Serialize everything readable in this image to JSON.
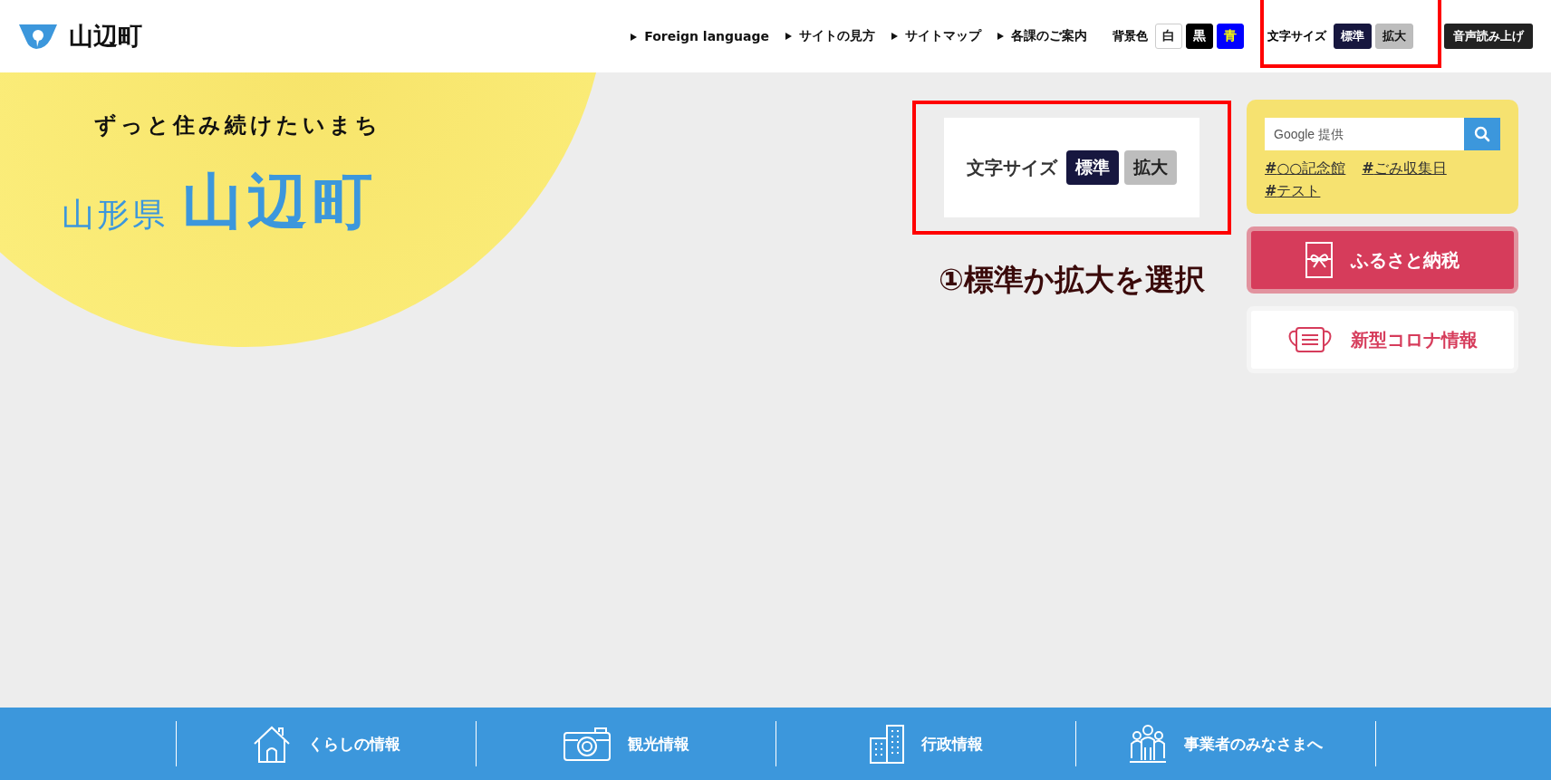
{
  "header": {
    "site_title": "山辺町",
    "nav_links": [
      "Foreign language",
      "サイトの見方",
      "サイトマップ",
      "各課のご案内"
    ],
    "bg_color": {
      "label": "背景色",
      "options": [
        {
          "label": "白",
          "kind": "white"
        },
        {
          "label": "黒",
          "kind": "black"
        },
        {
          "label": "青",
          "kind": "blue"
        }
      ]
    },
    "font_size": {
      "label": "文字サイズ",
      "highlighted": true,
      "options": [
        {
          "label": "標準",
          "selected": true
        },
        {
          "label": "拡大",
          "selected": false
        }
      ]
    },
    "read_aloud": "音声読み上げ"
  },
  "hero": {
    "tagline": "ずっと住み続けたいまち",
    "prefecture": "山形県",
    "town": "山辺町"
  },
  "callout": {
    "highlighted": true,
    "label": "文字サイズ",
    "options": [
      {
        "label": "標準",
        "selected": true
      },
      {
        "label": "拡大",
        "selected": false
      }
    ],
    "caption": "①標準か拡大を選択"
  },
  "search": {
    "placeholder": "Google 提供",
    "tags": [
      "**#**○○記念館",
      "**#**ごみ収集日",
      "**#**テスト"
    ]
  },
  "banners": [
    {
      "label": "ふるさと納税",
      "kind": "furusato"
    },
    {
      "label": "新型コロナ情報",
      "kind": "corona"
    }
  ],
  "bottom_nav": [
    {
      "label": "くらしの情報",
      "kind": "living"
    },
    {
      "label": "観光情報",
      "kind": "tourism"
    },
    {
      "label": "行政情報",
      "kind": "government"
    },
    {
      "label": "事業者のみなさまへ",
      "kind": "business"
    }
  ]
}
